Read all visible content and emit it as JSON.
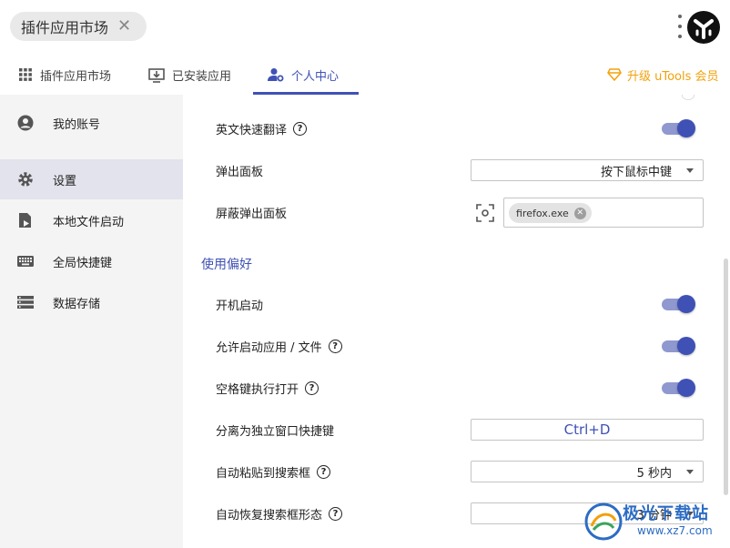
{
  "search": {
    "chip_text": "插件应用市场",
    "close_glyph": "✕"
  },
  "header": {
    "more_icon": "more-vertical-icon",
    "logo_icon": "utools-logo-icon"
  },
  "tabs": [
    {
      "label": "插件应用市场",
      "icon": "grid-icon",
      "active": false
    },
    {
      "label": "已安装应用",
      "icon": "installed-download-icon",
      "active": false
    },
    {
      "label": "个人中心",
      "icon": "user-settings-icon",
      "active": true
    }
  ],
  "upgrade": {
    "label": "升级 uTools 会员",
    "color": "#f2a10b"
  },
  "sidebar": {
    "items": [
      {
        "label": "我的账号",
        "icon": "account-circle-icon",
        "active": false
      },
      {
        "label": "设置",
        "icon": "gear-icon",
        "active": true
      },
      {
        "label": "本地文件启动",
        "icon": "file-launch-icon",
        "active": false
      },
      {
        "label": "全局快捷键",
        "icon": "keyboard-icon",
        "active": false
      },
      {
        "label": "数据存储",
        "icon": "storage-icon",
        "active": false
      }
    ]
  },
  "settings": {
    "english_translate": {
      "label": "英文快速翻译",
      "enabled": true
    },
    "popup_panel": {
      "label": "弹出面板",
      "value": "按下鼠标中键"
    },
    "block_popup": {
      "label": "屏蔽弹出面板",
      "chip": "firefox.exe"
    },
    "section_usage": "使用偏好",
    "auto_start": {
      "label": "开机启动",
      "enabled": true
    },
    "allow_launch": {
      "label": "允许启动应用 / 文件",
      "enabled": true
    },
    "space_open": {
      "label": "空格键执行打开",
      "enabled": true
    },
    "detach_hotkey": {
      "label": "分离为独立窗口快捷键",
      "value": "Ctrl+D"
    },
    "auto_paste": {
      "label": "自动粘贴到搜索框",
      "value": "5 秒内"
    },
    "auto_restore": {
      "label": "自动恢复搜索框形态",
      "value": "3 分钟"
    }
  },
  "watermark": {
    "text": "极光下载站",
    "url": "www.xz7.com"
  },
  "colors": {
    "accent": "#3f51b5",
    "accent_track": "#8f98cf",
    "sidebar_bg": "#f4f4f4",
    "sidebar_active": "#e2e3ec"
  }
}
